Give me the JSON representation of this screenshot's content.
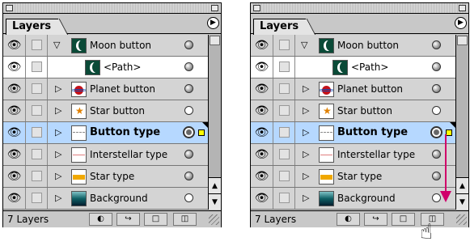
{
  "panels": [
    {
      "tab_label": "Layers",
      "layers": [
        {
          "name": "Moon button",
          "thumb": "moon",
          "expander": "open",
          "target": "filled"
        },
        {
          "name": "<Path>",
          "thumb": "moon",
          "expander": "none",
          "target": "filled",
          "sub": true
        },
        {
          "name": "Planet button",
          "thumb": "planet",
          "expander": "closed",
          "target": "filled"
        },
        {
          "name": "Star button",
          "thumb": "star",
          "expander": "closed",
          "target": "empty"
        },
        {
          "name": "Button type",
          "thumb": "btype",
          "expander": "closed",
          "target": "selected",
          "selected": true
        },
        {
          "name": "Interstellar type",
          "thumb": "itype",
          "expander": "closed",
          "target": "filled"
        },
        {
          "name": "Star type",
          "thumb": "stype",
          "expander": "closed",
          "target": "filled"
        },
        {
          "name": "Background",
          "thumb": "bg",
          "expander": "closed",
          "target": "empty"
        }
      ],
      "layer_count": "7 Layers"
    },
    {
      "tab_label": "Layers",
      "layers": [
        {
          "name": "Moon button",
          "thumb": "moon",
          "expander": "open",
          "target": "filled"
        },
        {
          "name": "<Path>",
          "thumb": "moon",
          "expander": "none",
          "target": "filled",
          "sub": true
        },
        {
          "name": "Planet button",
          "thumb": "planet",
          "expander": "closed",
          "target": "filled"
        },
        {
          "name": "Star button",
          "thumb": "star",
          "expander": "closed",
          "target": "empty"
        },
        {
          "name": "Button type",
          "thumb": "btype",
          "expander": "closed",
          "target": "selected",
          "selected": true
        },
        {
          "name": "Interstellar type",
          "thumb": "itype",
          "expander": "closed",
          "target": "filled"
        },
        {
          "name": "Star type",
          "thumb": "stype",
          "expander": "closed",
          "target": "filled"
        },
        {
          "name": "Background",
          "thumb": "bg",
          "expander": "closed",
          "target": "empty"
        }
      ],
      "layer_count": "7 Layers"
    }
  ],
  "colors": {
    "selection": "#b6d8ff",
    "drag_arrow": "#d0006a",
    "selection_box": "#ffff00"
  },
  "icons": {
    "visibility": "eye-icon",
    "menu": "panel-menu-arrow-icon",
    "footer": [
      "make-clipping-mask-icon",
      "create-new-sublayer-icon",
      "create-new-layer-icon",
      "trash-icon"
    ],
    "cursor": "pointing-hand-icon"
  }
}
